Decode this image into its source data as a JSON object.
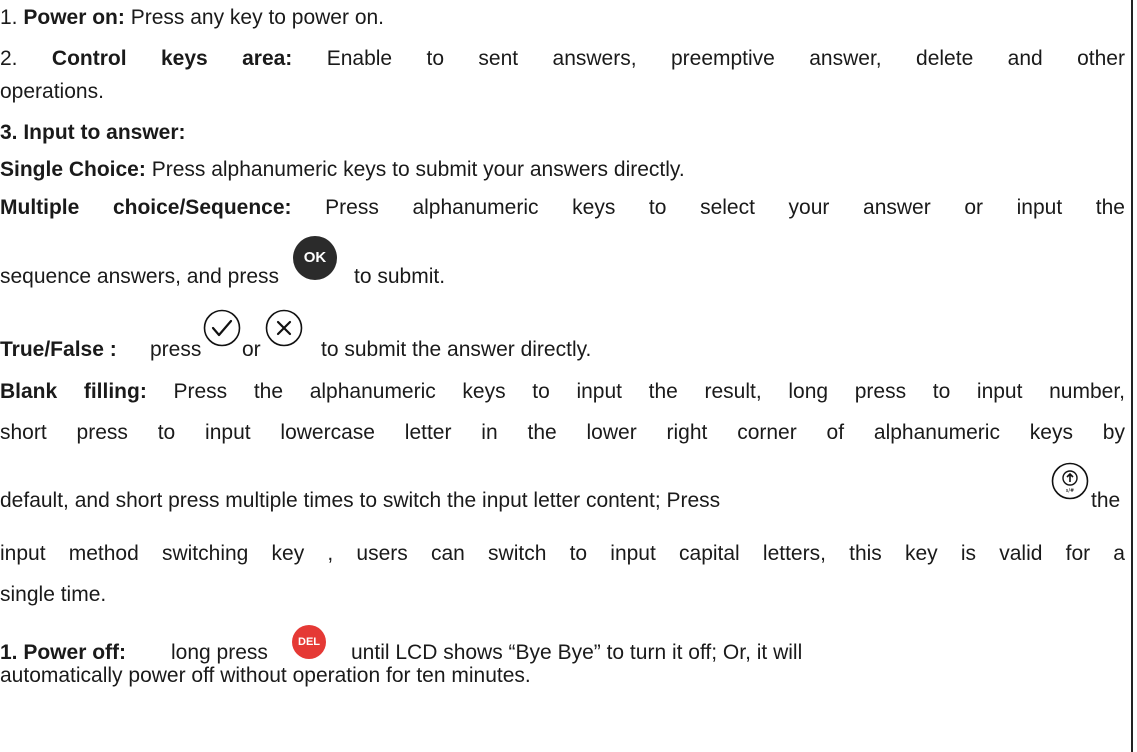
{
  "items": {
    "power_on": {
      "label": "1.",
      "title": "Power on:",
      "text": "Press any key to power on."
    },
    "control_keys": {
      "label": "2.",
      "title": "Control keys area:",
      "text_line1": "Enable to sent answers, preemptive answer, delete and other",
      "text_line2": "operations."
    },
    "input_to_answer": {
      "title": "3. Input to answer:"
    },
    "single_choice": {
      "title": "Single Choice:",
      "text": "Press alphanumeric keys to submit your answers directly."
    },
    "multiple_choice": {
      "title": "Multiple choice/Sequence:",
      "text_line1": "Press alphanumeric keys to select your answer or input the",
      "text_line2a": "sequence answers, and press",
      "text_line2b": "to submit."
    },
    "true_false": {
      "title": "True/False :",
      "text_a": "press",
      "text_b": "or",
      "text_c": "to submit the answer directly."
    },
    "blank_filling": {
      "title": "Blank filling:",
      "line1": "Press the alphanumeric keys to input the result, long press to input number,",
      "line2": "short press to input lowercase letter in the lower right corner of alphanumeric keys by",
      "line3a": "default, and short press multiple times to switch the input letter content; Press",
      "line3b": "the",
      "line4": "input method switching key , users can switch to input capital letters, this key is valid for a",
      "line5": "single time."
    },
    "power_off": {
      "title": "1. Power off:",
      "text_a": "long press",
      "text_b": "until LCD shows “Bye Bye” to turn it off; Or, it will",
      "text_line2": "automatically power off without operation for ten minutes."
    }
  },
  "icons": {
    "ok_label": "OK",
    "del_label": "DEL",
    "check": "check-circle-icon",
    "cross": "x-circle-icon",
    "shift": "shift-up-icon",
    "del_color": "#e53935",
    "ok_color": "#2b2b2b"
  }
}
